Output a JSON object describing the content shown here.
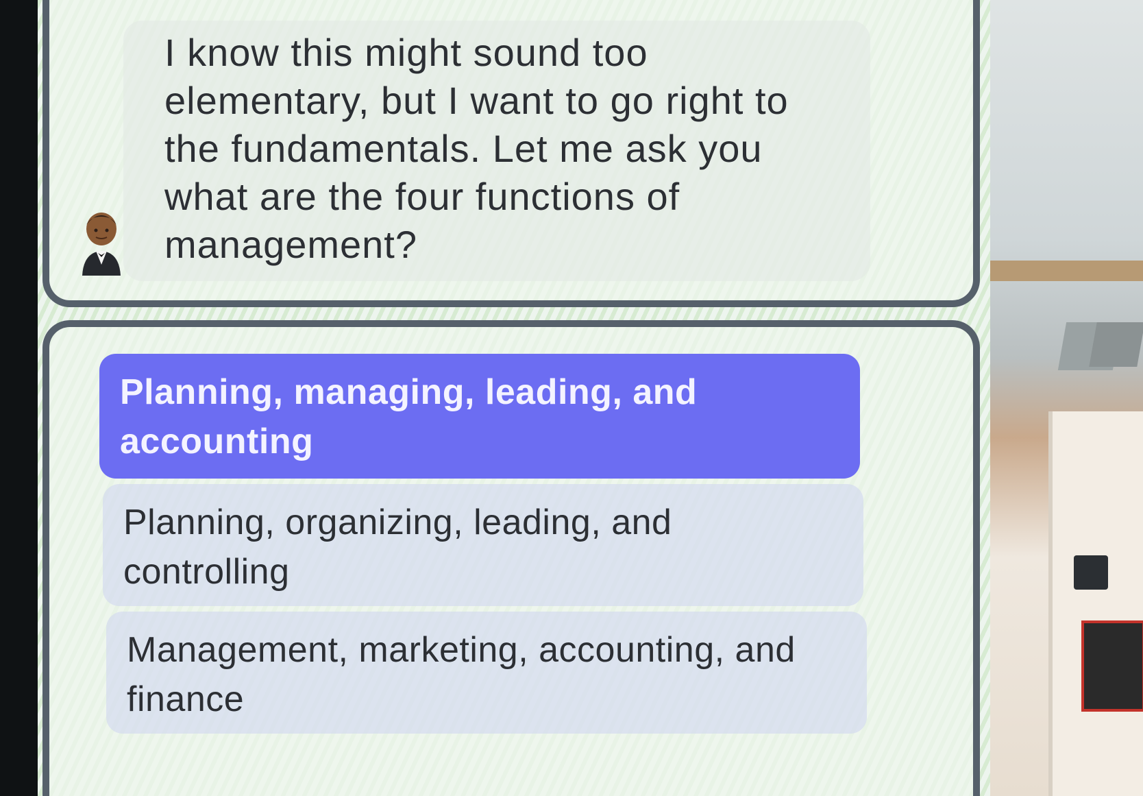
{
  "question": {
    "text": "I know this might sound too elementary, but I want to go right to the fundamentals.  Let me ask you what are the four functions of management?",
    "avatar_icon": "person-in-tuxedo-icon"
  },
  "answers": {
    "options": [
      {
        "label": "Planning, managing, leading, and accounting",
        "selected": true
      },
      {
        "label": "Planning, organizing, leading, and controlling",
        "selected": false
      },
      {
        "label": "Management, marketing, accounting, and finance",
        "selected": false
      }
    ]
  },
  "colors": {
    "selected_option": "#6c6df2",
    "unselected_option": "#cdd4f0",
    "card_border": "#56606b"
  }
}
